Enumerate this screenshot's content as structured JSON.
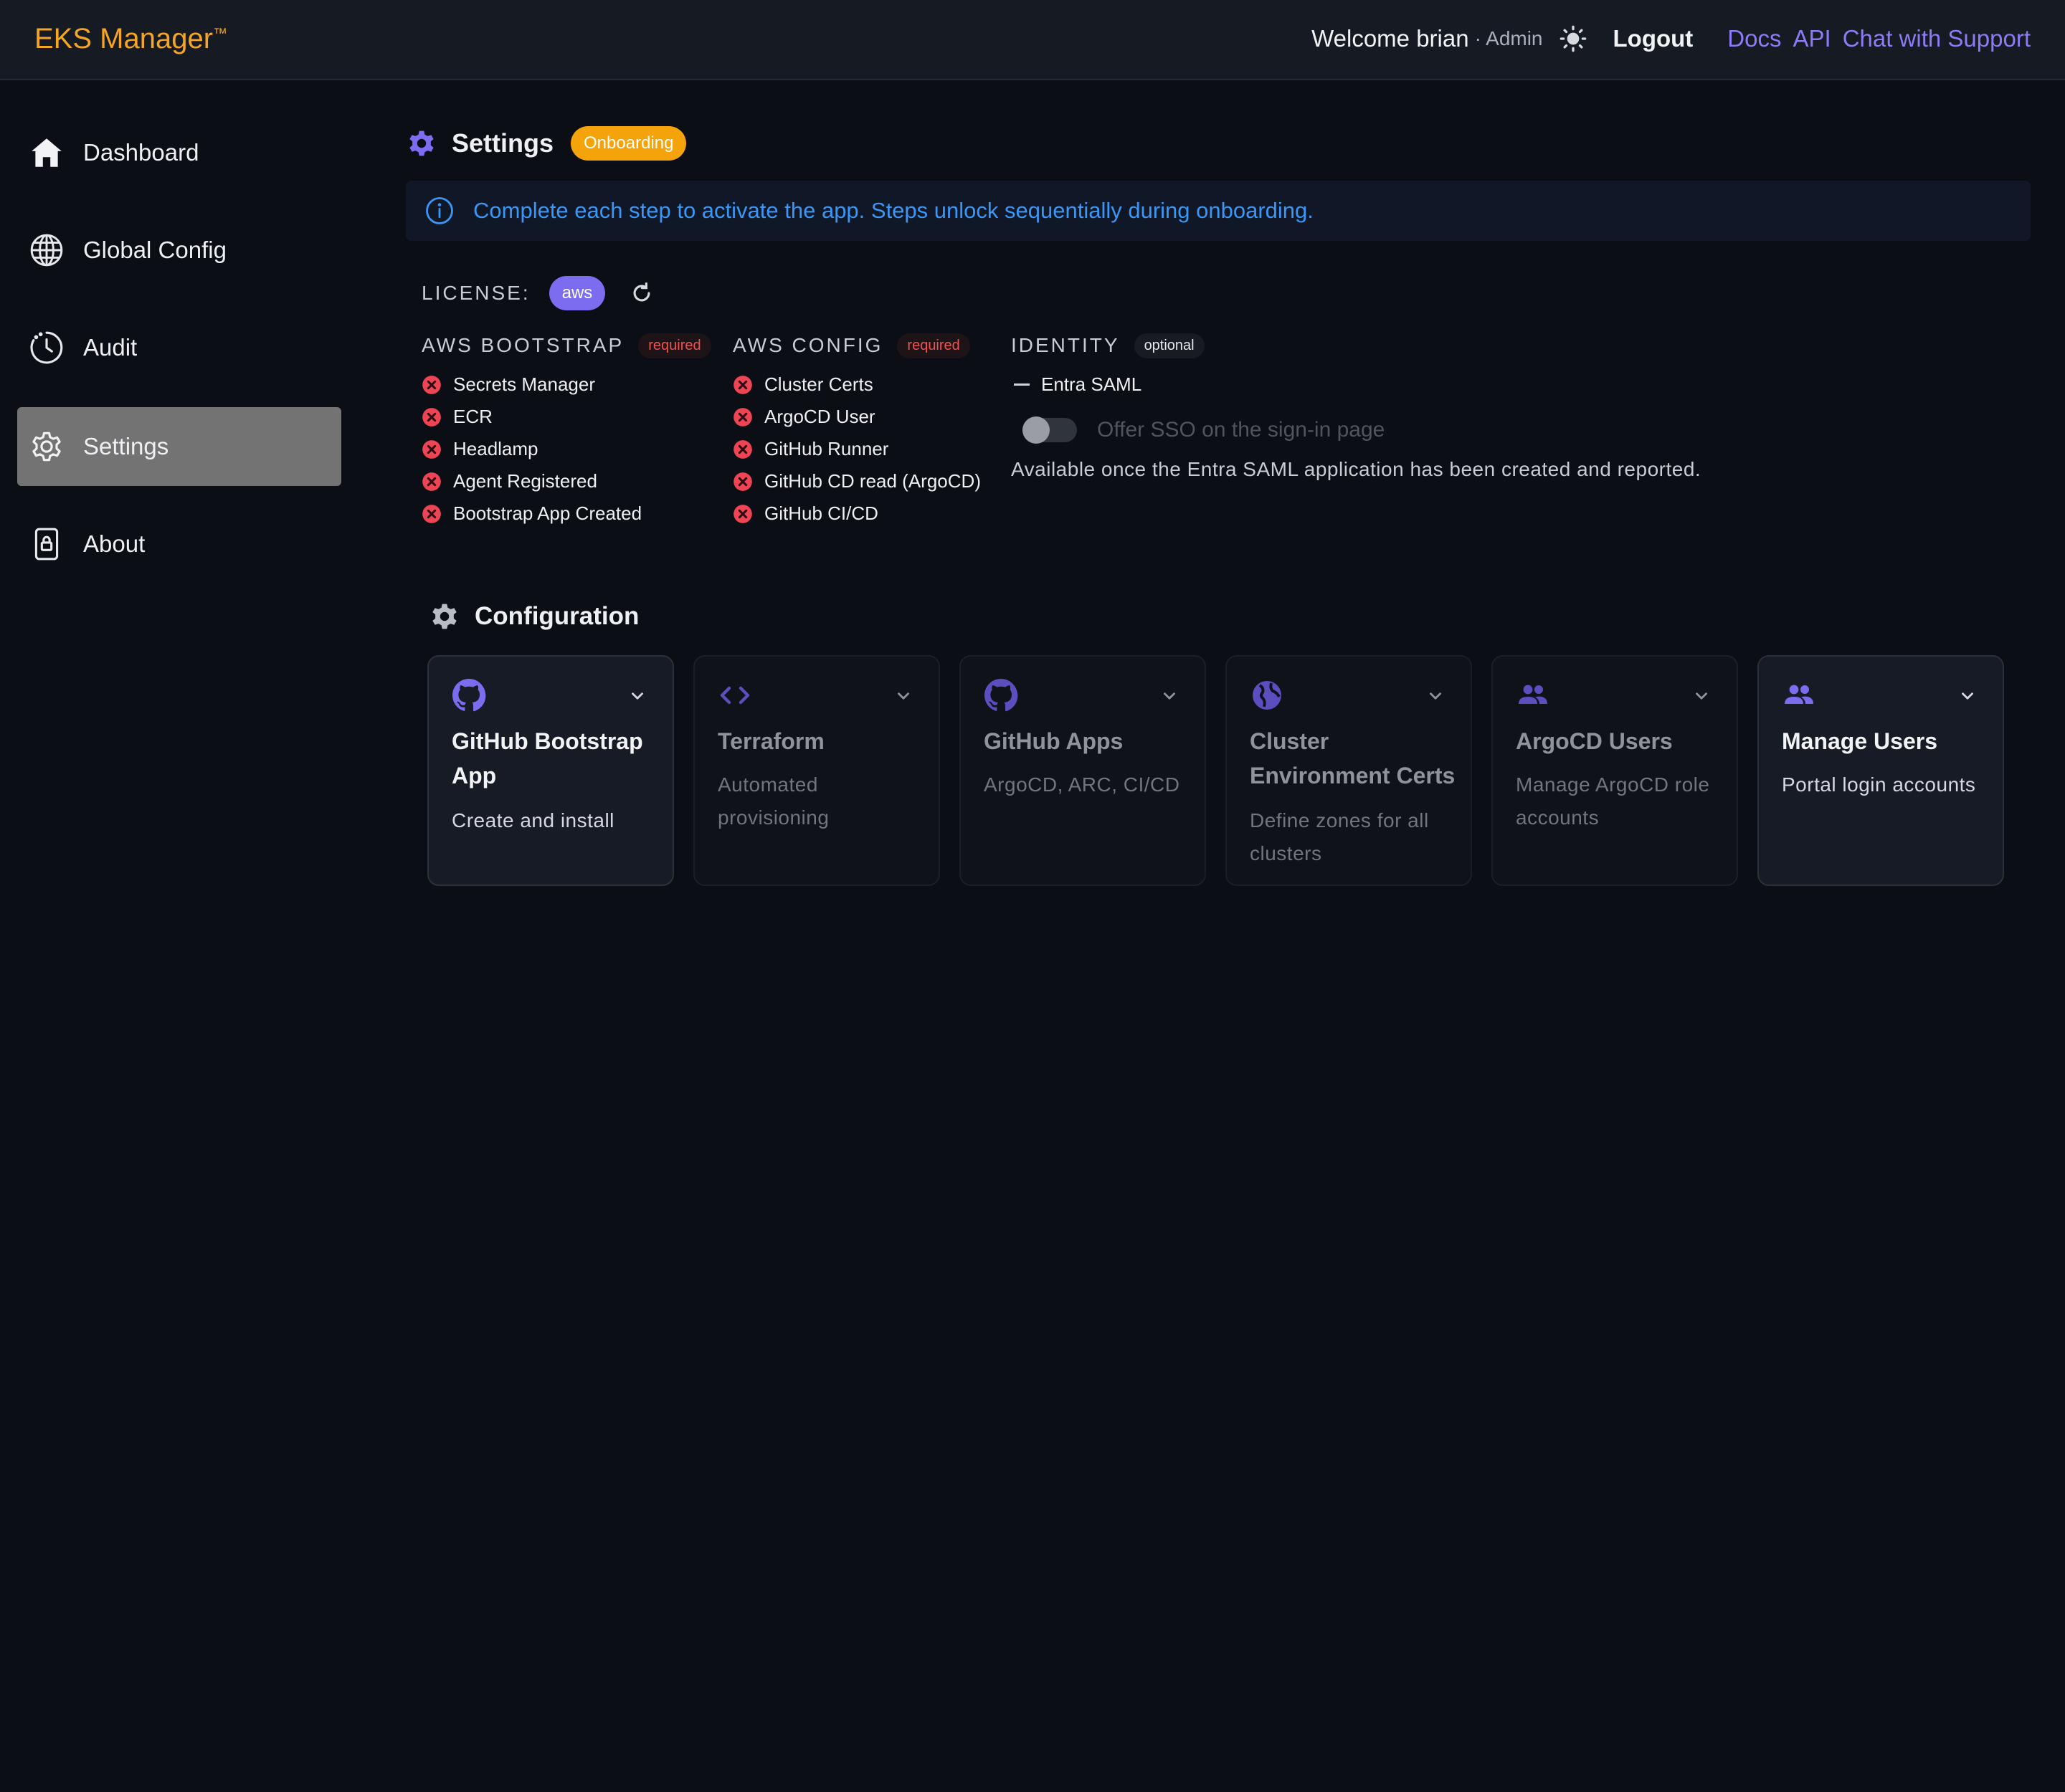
{
  "header": {
    "brand": "EKS Manager",
    "brand_mark": "™",
    "welcome": "Welcome brian",
    "role": "· Admin",
    "theme_icon": "sun-icon",
    "logout": "Logout",
    "links": [
      "Docs",
      "API",
      "Chat with Support"
    ],
    "brand_color": "#f5a524",
    "link_color": "#8b7cf6"
  },
  "sidebar": {
    "items": [
      {
        "label": "Dashboard",
        "icon": "home-icon"
      },
      {
        "label": "Global Config",
        "icon": "globe-icon"
      },
      {
        "label": "Audit",
        "icon": "clock-icon"
      },
      {
        "label": "Settings",
        "icon": "gear-icon",
        "active": true
      },
      {
        "label": "About",
        "icon": "lock-icon"
      }
    ]
  },
  "page": {
    "title": "Settings",
    "badge": "Onboarding",
    "info": "Complete each step to activate the app. Steps unlock sequentially during onboarding.",
    "license_label": "LICENSE:",
    "license_value": "aws"
  },
  "groups": {
    "bootstrap": {
      "title": "AWS BOOTSTRAP",
      "tag": "required",
      "items": [
        "Secrets Manager",
        "ECR",
        "Headlamp",
        "Agent Registered",
        "Bootstrap App Created"
      ]
    },
    "config": {
      "title": "AWS CONFIG",
      "tag": "required",
      "items": [
        "Cluster Certs",
        "ArgoCD User",
        "GitHub Runner",
        "GitHub CD read (ArgoCD)",
        "GitHub CI/CD"
      ]
    },
    "identity": {
      "title": "IDENTITY",
      "tag": "optional",
      "item": "Entra SAML",
      "toggle_label": "Offer SSO on the sign-in page",
      "note": "Available once the Entra SAML application has been created and reported."
    }
  },
  "configuration": {
    "title": "Configuration",
    "cards": [
      {
        "title": "GitHub Bootstrap App",
        "subtitle": "Create and install",
        "icon": "github-icon"
      },
      {
        "title": "Terraform",
        "subtitle": "Automated provisioning",
        "icon": "code-icon"
      },
      {
        "title": "GitHub Apps",
        "subtitle": "ArgoCD, ARC, CI/CD",
        "icon": "github-icon"
      },
      {
        "title": "Cluster Environment Certs",
        "subtitle": "Define zones for all clusters",
        "icon": "globe-icon"
      },
      {
        "title": "ArgoCD Users",
        "subtitle": "Manage ArgoCD role accounts",
        "icon": "users-icon"
      },
      {
        "title": "Manage Users",
        "subtitle": "Portal login accounts",
        "icon": "users-icon"
      }
    ]
  }
}
